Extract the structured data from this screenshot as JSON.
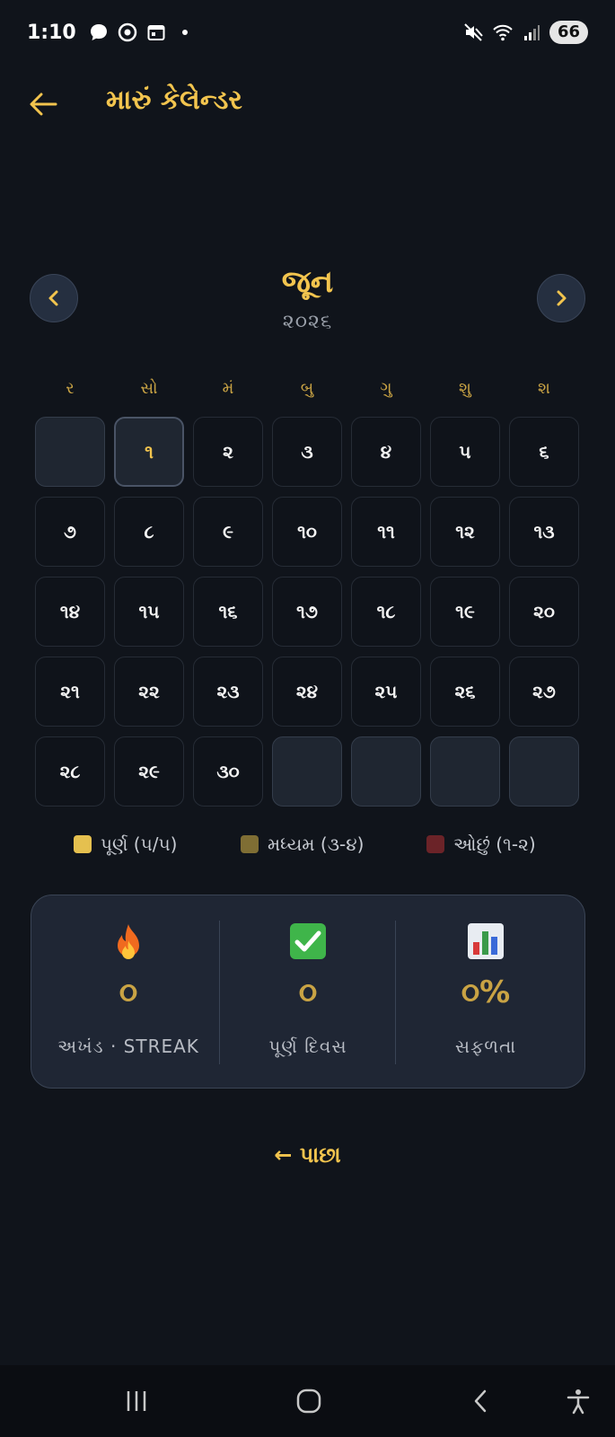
{
  "status_bar": {
    "time": "1:10",
    "battery": "66",
    "left_icons": [
      "chat-bubble-icon",
      "chrome-icon",
      "calendar-icon"
    ],
    "right_icons": [
      "mute-icon",
      "wifi-icon",
      "signal-icon"
    ]
  },
  "header": {
    "title": "મારું કેલેન્ડર",
    "back_icon": "arrow-left-icon"
  },
  "month_nav": {
    "month": "જૂન",
    "year": "૨૦૨૬"
  },
  "weekdays": [
    "ર",
    "સો",
    "મં",
    "બુ",
    "ગુ",
    "શુ",
    "શ"
  ],
  "calendar": {
    "leading_empty": 1,
    "today": "૧",
    "days": [
      "૧",
      "૨",
      "૩",
      "૪",
      "૫",
      "૬",
      "૭",
      "૮",
      "૯",
      "૧૦",
      "૧૧",
      "૧૨",
      "૧૩",
      "૧૪",
      "૧૫",
      "૧૬",
      "૧૭",
      "૧૮",
      "૧૯",
      "૨૦",
      "૨૧",
      "૨૨",
      "૨૩",
      "૨૪",
      "૨૫",
      "૨૬",
      "૨૭",
      "૨૮",
      "૨૯",
      "૩૦"
    ],
    "trailing_empty": 4
  },
  "legend": [
    {
      "label": "પૂર્ણ (૫/૫)",
      "color": "#e5c04f"
    },
    {
      "label": "મધ્યમ (૩-૪)",
      "color": "#7f6e34"
    },
    {
      "label": "ઓછું (૧-૨)",
      "color": "#6b2328"
    }
  ],
  "stats": [
    {
      "icon": "fire-icon",
      "value": "૦",
      "label": "અખંડ · STREAK"
    },
    {
      "icon": "check-mark-button-icon",
      "value": "૦",
      "label": "પૂર્ણ દિવસ"
    },
    {
      "icon": "bar-chart-icon",
      "value": "૦%",
      "label": "સફળતા"
    }
  ],
  "back_link": "← પાછા",
  "colors": {
    "background": "#10141b",
    "accent": "#f2c44e",
    "accent_muted": "#c9a344",
    "card": "#1f2634"
  }
}
